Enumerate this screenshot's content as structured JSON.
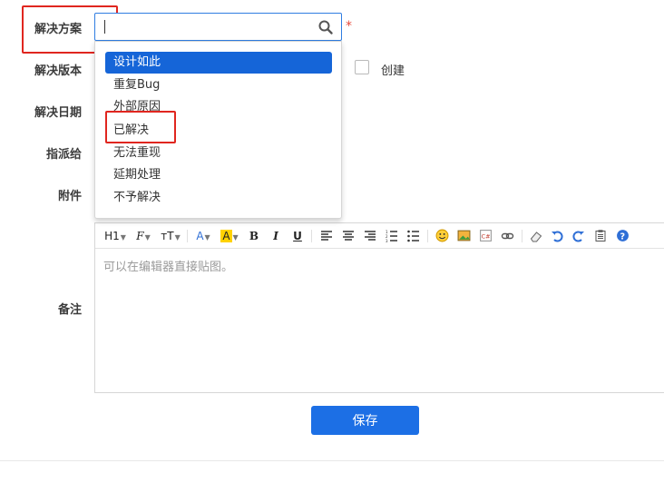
{
  "form": {
    "resolution_label": "解决方案",
    "version_label": "解决版本",
    "date_label": "解决日期",
    "assign_label": "指派给",
    "attachment_label": "附件",
    "comment_label": "备注",
    "required_mark": "*",
    "create_label": "创建"
  },
  "dropdown": {
    "options": [
      "设计如此",
      "重复Bug",
      "外部原因",
      "已解决",
      "无法重现",
      "延期处理",
      "不予解决"
    ],
    "selected": "设计如此",
    "highlighted": "已解决"
  },
  "editor": {
    "placeholder": "可以在编辑器直接贴图。",
    "toolbar": {
      "heading": "H1",
      "font": "F",
      "size": "тT",
      "font_color": "A",
      "bg_color": "A",
      "bold": "B",
      "italic": "I",
      "underline": "U"
    }
  },
  "actions": {
    "save_label": "保存"
  },
  "colors": {
    "accent": "#1c6fe5",
    "highlight_box": "#e0261f",
    "required": "#e74c3c"
  }
}
